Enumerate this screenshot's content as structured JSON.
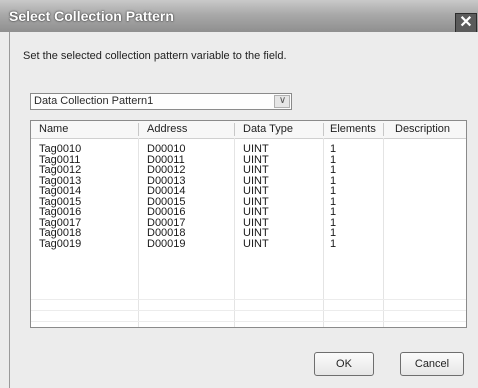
{
  "window": {
    "title": "Select Collection Pattern",
    "close_glyph": "✕"
  },
  "instruction": "Set the selected collection pattern variable to the field.",
  "pattern_select": {
    "value": "Data Collection Pattern1",
    "arrow_glyph": "∨"
  },
  "table": {
    "columns": [
      "Name",
      "Address",
      "Data Type",
      "Elements",
      "Description"
    ],
    "rows": [
      [
        "Tag0010",
        "D00010",
        "UINT",
        "1",
        ""
      ],
      [
        "Tag0011",
        "D00011",
        "UINT",
        "1",
        ""
      ],
      [
        "Tag0012",
        "D00012",
        "UINT",
        "1",
        ""
      ],
      [
        "Tag0013",
        "D00013",
        "UINT",
        "1",
        ""
      ],
      [
        "Tag0014",
        "D00014",
        "UINT",
        "1",
        ""
      ],
      [
        "Tag0015",
        "D00015",
        "UINT",
        "1",
        ""
      ],
      [
        "Tag0016",
        "D00016",
        "UINT",
        "1",
        ""
      ],
      [
        "Tag0017",
        "D00017",
        "UINT",
        "1",
        ""
      ],
      [
        "Tag0018",
        "D00018",
        "UINT",
        "1",
        ""
      ],
      [
        "Tag0019",
        "D00019",
        "UINT",
        "1",
        ""
      ]
    ]
  },
  "buttons": {
    "ok": "OK",
    "cancel": "Cancel"
  }
}
